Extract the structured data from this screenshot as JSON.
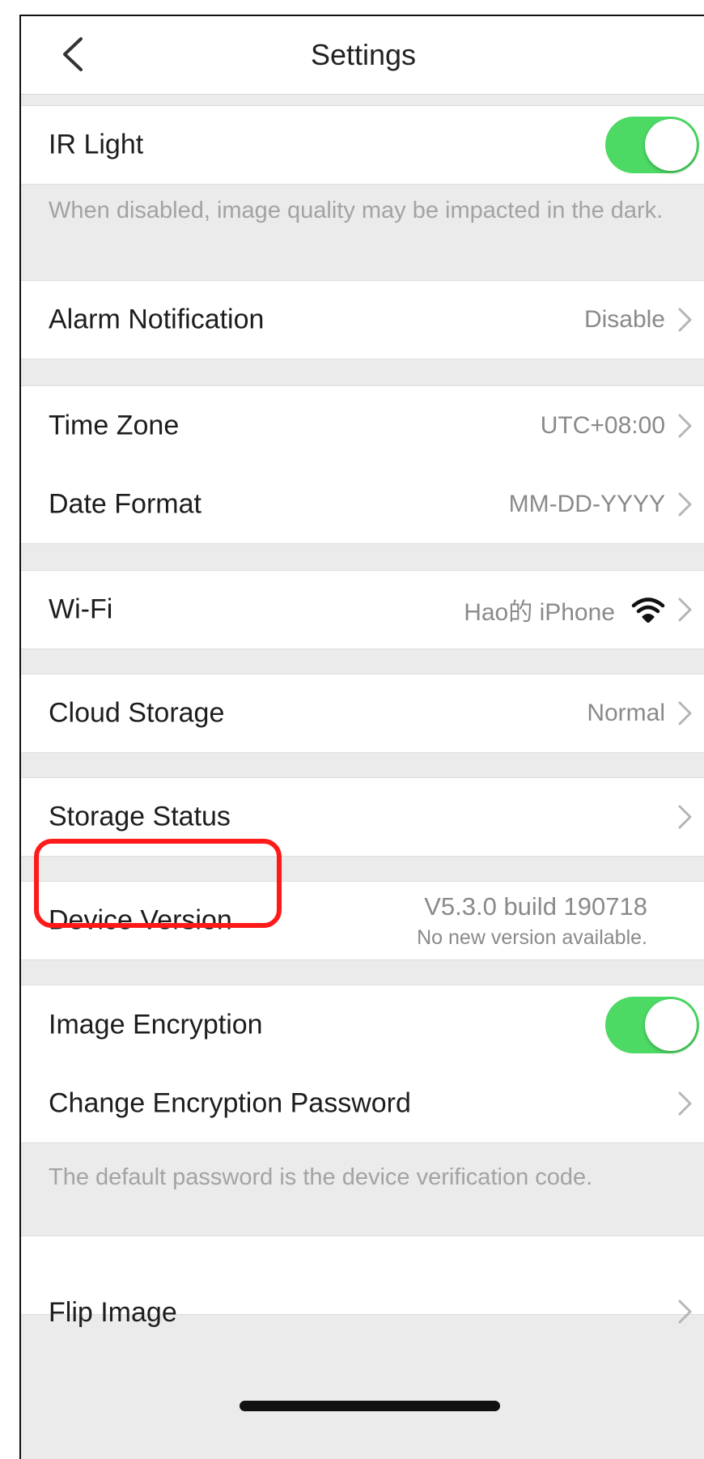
{
  "header": {
    "title": "Settings"
  },
  "ir_light": {
    "label": "IR Light",
    "enabled": true,
    "note": "When disabled, image quality may be impacted in the dark."
  },
  "alarm_notification": {
    "label": "Alarm Notification",
    "value": "Disable"
  },
  "time_zone": {
    "label": "Time Zone",
    "value": "UTC+08:00"
  },
  "date_format": {
    "label": "Date Format",
    "value": "MM-DD-YYYY"
  },
  "wifi": {
    "label": "Wi-Fi",
    "value": "Hao的 iPhone",
    "icon": "wifi-icon"
  },
  "cloud_storage": {
    "label": "Cloud Storage",
    "value": "Normal"
  },
  "storage_status": {
    "label": "Storage Status",
    "highlight_color": "#ff1a1a"
  },
  "device_version": {
    "label": "Device Version",
    "version": "V5.3.0 build 190718",
    "status": "No new version available."
  },
  "image_encryption": {
    "label": "Image Encryption",
    "enabled": true
  },
  "change_password": {
    "label": "Change Encryption Password",
    "note": "The default password is the device verification code."
  },
  "flip_image": {
    "label": "Flip Image"
  },
  "colors": {
    "toggle_on": "#4cd964",
    "background": "#ebebeb",
    "secondary_text": "#8a8a8a"
  }
}
